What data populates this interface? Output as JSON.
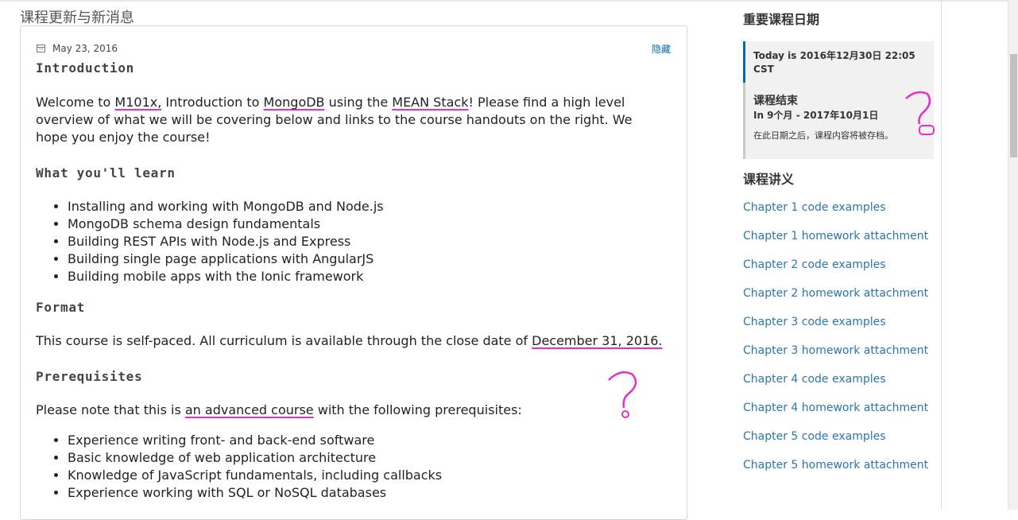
{
  "page": {
    "title": "课程更新与新消息"
  },
  "update": {
    "date": "May 23, 2016",
    "hide_label": "隐藏",
    "intro_heading": "Introduction",
    "intro_pre": "Welcome to ",
    "intro_course": "M101x,",
    "intro_mid": " Introduction to ",
    "intro_mongo": "MongoDB",
    "intro_using": " using the ",
    "intro_mean": "MEAN Stack",
    "intro_post": "! Please find a high level overview of what we will be covering below and links to the course handouts on the right. We hope you enjoy the course!",
    "learn_heading": "What you'll learn",
    "learn_items": [
      "Installing and working with MongoDB and Node.js",
      "MongoDB schema design fundamentals",
      "Building REST APIs with Node.js and Express",
      "Building single page applications with AngularJS",
      "Building mobile apps with the Ionic framework"
    ],
    "format_heading": "Format",
    "format_pre": "This course is self-paced. All curriculum is available through the close date of ",
    "format_date": "December 31, 2016.",
    "prereq_heading": "Prerequisites",
    "prereq_pre": "Please note that this is ",
    "prereq_adv": "an advanced course",
    "prereq_post": " with the following prerequisites:",
    "prereq_items": [
      "Experience writing front- and back-end software",
      "Basic knowledge of web application architecture",
      "Knowledge of JavaScript fundamentals, including callbacks",
      "Experience working with SQL or NoSQL databases"
    ]
  },
  "sidebar": {
    "dates_title": "重要课程日期",
    "today_text": "Today is 2016年12月30日 22:05 CST",
    "end_title": "课程结束",
    "end_range": "In 9个月 - 2017年10月1日",
    "end_note": "在此日期之后，课程内容将被存档。",
    "handouts_title": "课程讲义",
    "handouts": [
      "Chapter 1 code examples",
      "Chapter 1 homework attachment",
      "Chapter 2 code examples",
      "Chapter 2 homework attachment",
      "Chapter 3 code examples",
      "Chapter 3 homework attachment",
      "Chapter 4 code examples",
      "Chapter 4 homework attachment",
      "Chapter 5 code examples",
      "Chapter 5 homework attachment"
    ]
  },
  "colors": {
    "link": "#2a76ad",
    "accent": "#0a68a8",
    "annotation": "#e62ec8"
  }
}
